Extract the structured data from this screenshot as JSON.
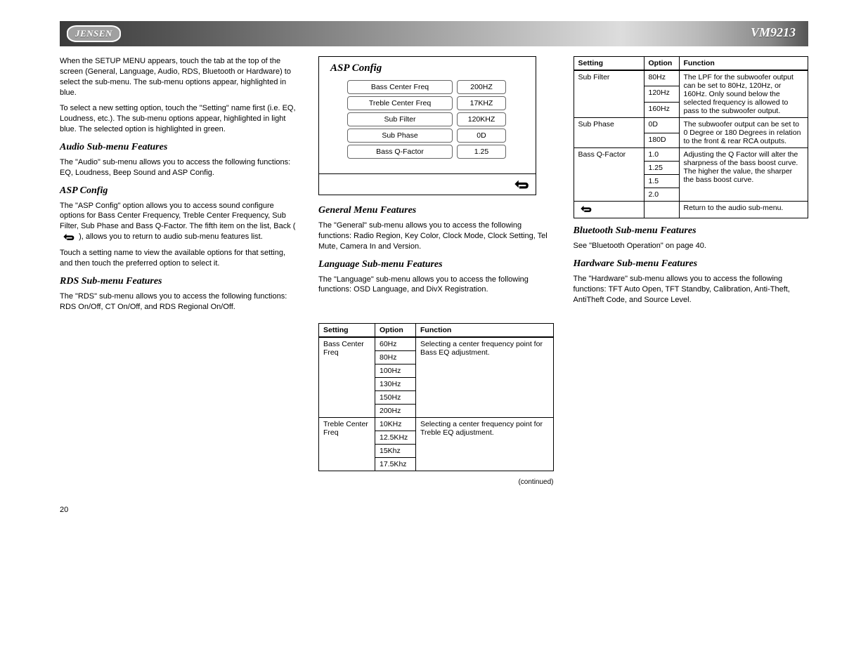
{
  "header": {
    "logo": "JENSEN",
    "model": "VM9213"
  },
  "left": {
    "p1": "When the SETUP MENU appears, touch the tab at the top of the screen (General, Language, Audio, RDS, Bluetooth or Hardware) to select the sub-menu. The sub-menu options appear, highlighted in blue.",
    "p2": "To select a new setting option, touch the \"Setting\" name first (i.e. EQ, Loudness, etc.). The sub-menu options appear, highlighted in light blue. The selected option is highlighted in green.",
    "title1": "Audio Sub-menu Features",
    "p3": "The \"Audio\" sub-menu allows you to access the following functions: EQ, Loudness, Beep Sound and ASP Config.",
    "title2": "ASP Config",
    "p4a": "The \"ASP Config\" option allows you to access sound configure options for Bass Center Frequency, Treble Center Frequency, Sub Filter, Sub Phase and Bass Q-Factor. The fifth item on the list, Back (",
    "p4b": "), allows you to return to audio sub-menu features list.",
    "p5": "Touch a setting name to view the available options for that setting, and then touch the preferred option to select it.",
    "title3": "RDS Sub-menu Features",
    "p6": "The \"RDS\" sub-menu allows you to access the following functions: RDS On/Off, CT On/Off, and RDS Regional On/Off."
  },
  "mid": {
    "asp_panel": {
      "title": "ASP Config",
      "rows": [
        {
          "label": "Bass Center Freq",
          "value": "200HZ"
        },
        {
          "label": "Treble Center Freq",
          "value": "17KHZ"
        },
        {
          "label": "Sub Filter",
          "value": "120KHZ"
        },
        {
          "label": "Sub Phase",
          "value": "0D"
        },
        {
          "label": "Bass Q-Factor",
          "value": "1.25"
        }
      ]
    },
    "title1": "General Menu Features",
    "p1": "The \"General\" sub-menu allows you to access the following functions: Radio Region, Key Color, Clock Mode, Clock Setting, Tel Mute, Camera In and Version.",
    "title2": "Language Sub-menu Features",
    "p2": "The \"Language\" sub-menu allows you to access the following functions: OSD Language, and DivX Registration.",
    "table1": {
      "head": [
        "Setting",
        "Option",
        "Function"
      ],
      "rows": [
        {
          "setting": "Bass Center Freq",
          "options": [
            "60Hz",
            "80Hz",
            "100Hz",
            "130Hz",
            "150Hz",
            "200Hz"
          ],
          "fn": "Selecting a center frequency point for Bass EQ adjustment."
        },
        {
          "setting": "Treble Center Freq",
          "options": [
            "10KHz",
            "12.5KHz",
            "15Khz",
            "17.5Khz"
          ],
          "fn": "Selecting a center frequency point for Treble EQ adjustment."
        }
      ]
    },
    "cont": "(continued)"
  },
  "right": {
    "table2": {
      "head": [
        "Setting",
        "Option",
        "Function"
      ],
      "rows": [
        {
          "setting": "Sub Filter",
          "options": [
            "80Hz",
            "120Hz",
            "160Hz"
          ],
          "fn": "The LPF for the subwoofer output can be set to 80Hz, 120Hz, or 160Hz. Only sound below the selected frequency is allowed to pass to the subwoofer output."
        },
        {
          "setting": "Sub Phase",
          "options": [
            "0D",
            "180D"
          ],
          "fn": "The subwoofer output can be set to 0 Degree or 180 Degrees in relation to the front & rear RCA outputs."
        },
        {
          "setting": "Bass Q-Factor",
          "options": [
            "1.0",
            "1.25",
            "1.5",
            "2.0"
          ],
          "fn": "Adjusting the Q Factor will alter the sharpness of the bass boost curve. The higher the value, the sharper the bass boost curve."
        },
        {
          "setting": "__BACK__",
          "options": [
            ""
          ],
          "fn": "Return to the audio sub-menu."
        }
      ]
    },
    "title1": "Bluetooth Sub-menu Features",
    "p1": "See \"Bluetooth Operation\" on page 40.",
    "title2": "Hardware Sub-menu Features",
    "p2": "The \"Hardware\" sub-menu allows you to access the following functions: TFT Auto Open, TFT Standby, Calibration, Anti-Theft, AntiTheft Code, and Source Level."
  },
  "page_number": "20"
}
